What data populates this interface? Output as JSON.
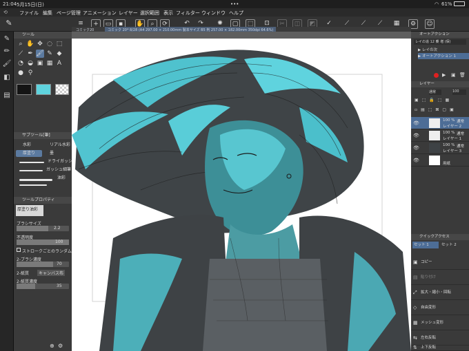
{
  "status": {
    "time": "21:04",
    "date": "5月15日(日)",
    "dots": "•••",
    "battery": "61%"
  },
  "menu": [
    "ファイル",
    "編集",
    "ページ管理",
    "アニメーション",
    "レイヤー",
    "選択範囲",
    "表示",
    "フィルター",
    "ウィンドウ",
    "ヘルプ"
  ],
  "tabs": {
    "tab1": "コミック20",
    "tab2": "コミック 20* 8/28 (A4 297.00 × 210.00mm 製本サイズ B5 判 257.00 × 182.00mm 350dpi 64.6%)"
  },
  "tool_panel": {
    "title": "ツール",
    "subtool_title": "サブツール[筆]",
    "subtools": [
      "水彩",
      "リアル水彩",
      "厚塗り",
      "墨",
      "ドライガッシュ",
      "ガッシュ細筆",
      "油彩"
    ],
    "property_title": "ツールプロパティ",
    "property_preset": "厚塗り油彩",
    "brush_size_label": "ブラシサイズ",
    "brush_size": "2.2",
    "opacity_label": "不透明度",
    "opacity": "100",
    "stroke_random_label": "ストロークごとのランダム変化",
    "brush_density_label": "2-ブラシ濃度",
    "brush_density": "70",
    "paper_label": "2-紙質",
    "paper_value": "キャンバス布",
    "paper_density_label": "2-紙質濃度",
    "paper_density": "35"
  },
  "colors": {
    "main": "#141414",
    "sub": "#5fd3de",
    "accent": "#5b7aa0",
    "rec": "#e02020"
  },
  "auto_action": {
    "title": "オートアクション",
    "set": "レイの追 12 乗 増 (保)",
    "items": [
      "レイの次",
      "オートアクション 1"
    ]
  },
  "layers": {
    "title": "レイヤー",
    "blend": "通常",
    "opacity": "100",
    "items": [
      {
        "pct": "100 %",
        "mode": "通常",
        "name": "レイヤー 2"
      },
      {
        "pct": "100 %",
        "mode": "通常",
        "name": "レイヤー 1"
      },
      {
        "pct": "100 %",
        "mode": "通常",
        "name": "レイヤー 3"
      },
      {
        "pct": "",
        "mode": "",
        "name": "用紙"
      }
    ]
  },
  "quick_access": {
    "title": "クイックアクセス",
    "tab1": "セット 1",
    "tab2": "セット 2",
    "items": [
      "コピー",
      "貼り付け",
      "拡大・縮小・回転",
      "自由変形",
      "メッシュ変形",
      "左右反転",
      "上下反転"
    ]
  }
}
